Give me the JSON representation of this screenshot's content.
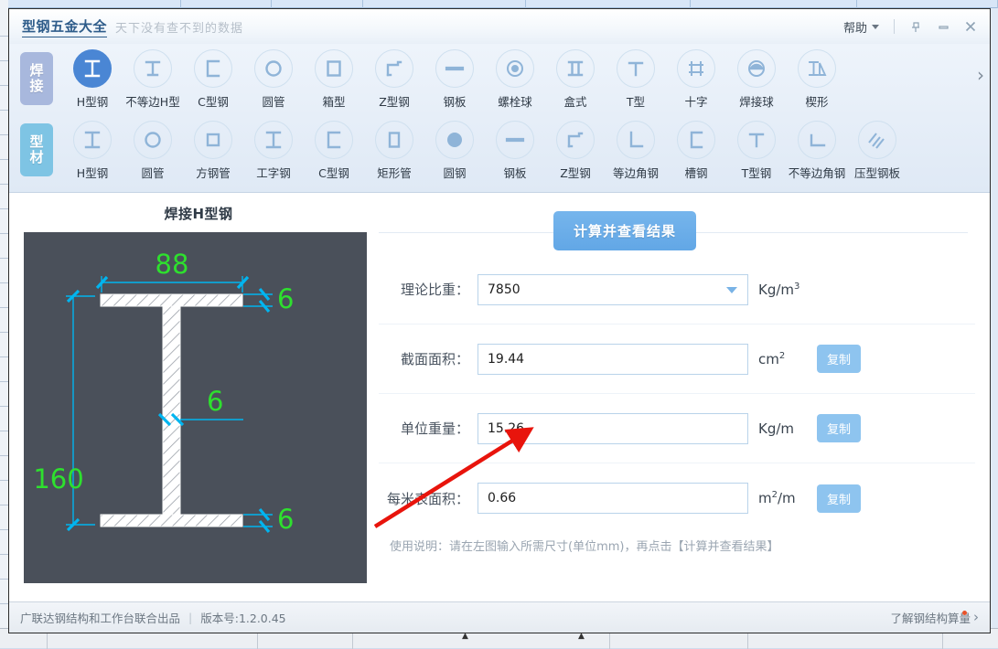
{
  "window": {
    "title": "型钢五金大全",
    "slogan": "天下没有查不到的数据",
    "help_label": "帮助",
    "pin_icon": "pin-icon",
    "minimize_icon": "minimize-icon",
    "close_icon": "close-icon"
  },
  "toolbar": {
    "scroll_right": "›",
    "rows": [
      {
        "category": "焊接",
        "category_key": "welded",
        "items": [
          {
            "label": "H型钢",
            "icon": "i-beam-icon",
            "active": true
          },
          {
            "label": "不等边H型",
            "icon": "unequal-h-icon",
            "active": false
          },
          {
            "label": "C型钢",
            "icon": "c-channel-icon",
            "active": false
          },
          {
            "label": "圆管",
            "icon": "round-tube-icon",
            "active": false
          },
          {
            "label": "箱型",
            "icon": "box-section-icon",
            "active": false
          },
          {
            "label": "Z型钢",
            "icon": "z-section-icon",
            "active": false
          },
          {
            "label": "钢板",
            "icon": "steel-plate-icon",
            "active": false
          },
          {
            "label": "螺栓球",
            "icon": "bolt-ball-icon",
            "active": false
          },
          {
            "label": "盒式",
            "icon": "boxed-icon",
            "active": false
          },
          {
            "label": "T型",
            "icon": "t-section-icon",
            "active": false
          },
          {
            "label": "十字",
            "icon": "cross-section-icon",
            "active": false
          },
          {
            "label": "焊接球",
            "icon": "welded-ball-icon",
            "active": false
          },
          {
            "label": "楔形",
            "icon": "wedge-icon",
            "active": false
          }
        ]
      },
      {
        "category": "型材",
        "category_key": "profile",
        "items": [
          {
            "label": "H型钢",
            "icon": "i-beam-icon",
            "active": false
          },
          {
            "label": "圆管",
            "icon": "round-tube-icon",
            "active": false
          },
          {
            "label": "方钢管",
            "icon": "square-tube-icon",
            "active": false
          },
          {
            "label": "工字钢",
            "icon": "i-steel-icon",
            "active": false
          },
          {
            "label": "C型钢",
            "icon": "c-channel-icon",
            "active": false
          },
          {
            "label": "矩形管",
            "icon": "rect-tube-icon",
            "active": false
          },
          {
            "label": "圆钢",
            "icon": "round-bar-icon",
            "active": false
          },
          {
            "label": "钢板",
            "icon": "steel-plate-icon",
            "active": false
          },
          {
            "label": "Z型钢",
            "icon": "z-section-icon",
            "active": false
          },
          {
            "label": "等边角钢",
            "icon": "equal-angle-icon",
            "active": false
          },
          {
            "label": "槽钢",
            "icon": "channel-steel-icon",
            "active": false
          },
          {
            "label": "T型钢",
            "icon": "t-steel-icon",
            "active": false
          },
          {
            "label": "不等边角钢",
            "icon": "unequal-angle-icon",
            "active": false
          },
          {
            "label": "压型钢板",
            "icon": "profiled-plate-icon",
            "active": false
          }
        ]
      }
    ]
  },
  "diagram": {
    "title": "焊接H型钢",
    "background_color": "#4a505a",
    "dimension_color": "#00b5f0",
    "value_color": "#2ee02e",
    "dims": {
      "flange_width": "88",
      "height": "160",
      "top_flange_thickness": "6",
      "web_thickness": "6",
      "bottom_flange_thickness": "6"
    }
  },
  "form": {
    "calc_button": "计算并查看结果",
    "copy_label": "复制",
    "fields": [
      {
        "label": "理论比重：",
        "value": "7850",
        "unit": "Kg/m",
        "unit_sup": "3",
        "type": "select",
        "copy": false
      },
      {
        "label": "截面面积：",
        "value": "19.44",
        "unit": "cm",
        "unit_sup": "2",
        "type": "text",
        "copy": true
      },
      {
        "label": "单位重量：",
        "value": "15.26",
        "unit": "Kg/m",
        "unit_sup": "",
        "type": "text",
        "copy": true
      },
      {
        "label": "每米表面积：",
        "value": "0.66",
        "unit": "m",
        "unit_sup": "2",
        "unit_suffix": "/m",
        "type": "text",
        "copy": true
      }
    ],
    "usage_note": "使用说明：请在左图输入所需尺寸(单位mm)，再点击【计算并查看结果】"
  },
  "annotation": {
    "arrow_color": "#e8140c"
  },
  "statusbar": {
    "producer": "广联达钢结构和工作台联合出品",
    "separator": "|",
    "version": "版本号:1.2.0.45",
    "link": "了解钢结构算量",
    "chevron": "›"
  }
}
